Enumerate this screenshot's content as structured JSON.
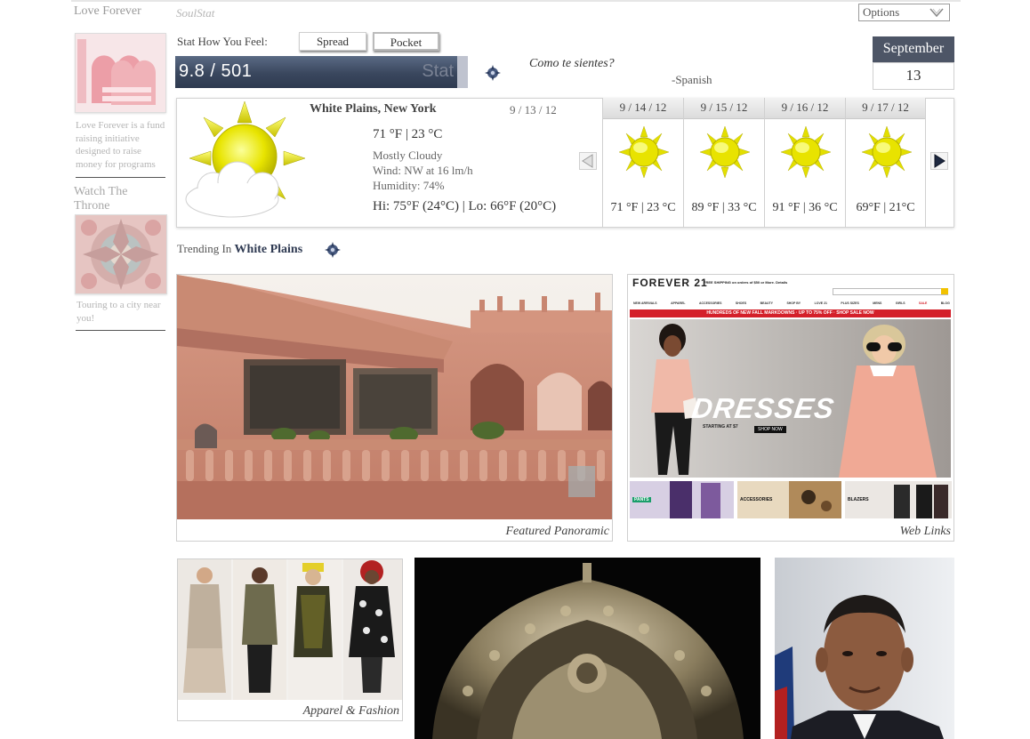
{
  "sidebar": {
    "title": "Love Forever",
    "blurb": "Love Forever is a fund raising initiative designed to raise money for programs",
    "section2_title": "Watch The Throne",
    "section2_text": "Touring to a city near you!"
  },
  "header": {
    "brand": "SoulStat",
    "options_label": "Options",
    "stat_label": "Stat How You Feel:",
    "toggle": [
      "Spread",
      "Pocket"
    ],
    "stat_value": "9.8 / 501",
    "stat_button": "Stat",
    "question": "Como te sientes?",
    "language": "-Spanish",
    "month": "September",
    "day": "13"
  },
  "weather": {
    "location": "White Plains, New York",
    "date": "9 / 13 / 12",
    "current_temp": "71 °F | 23 °C",
    "condition": "Mostly Cloudy",
    "wind": "Wind: NW at 16 lm/h",
    "humidity": "Humidity: 74%",
    "hilo": "Hi: 75°F (24°C) | Lo: 66°F (20°C)",
    "forecast": [
      {
        "date": "9 / 14 / 12",
        "temp": "71 °F | 23 °C"
      },
      {
        "date": "9 / 15 / 12",
        "temp": "89 °F | 33 °C"
      },
      {
        "date": "9 / 16 / 12",
        "temp": "91 °F | 36 °C"
      },
      {
        "date": "9 / 17 / 12",
        "temp": "69°F | 21°C"
      }
    ]
  },
  "trending": {
    "prefix": "Trending In",
    "place": "White Plains"
  },
  "cards": {
    "panoramic_caption": "Featured Panoramic",
    "weblinks_caption": "Web Links",
    "apparel_caption": "Apparel & Fashion"
  },
  "forever21": {
    "logo": "FOREVER 21",
    "shipping": "FREE SHIPPING on orders of $50 or More. Details",
    "nav": [
      "NEW ARRIVALS",
      "APPAREL",
      "ACCESSORIES",
      "SHOES",
      "BEAUTY",
      "SHOP BY",
      "LOVE 21",
      "PLUS SIZES",
      "MENS",
      "GIRLS",
      "SALE",
      "BLOG"
    ],
    "banner": "HUNDREDS OF NEW FALL MARKDOWNS · UP TO 75% OFF · SHOP SALE NOW",
    "hero_title": "DRESSES",
    "hero_sub": "STARTING AT $7",
    "hero_cta": "SHOP NOW",
    "tiles": [
      "PANTS",
      "ACCESSORIES",
      "BLAZERS"
    ]
  }
}
